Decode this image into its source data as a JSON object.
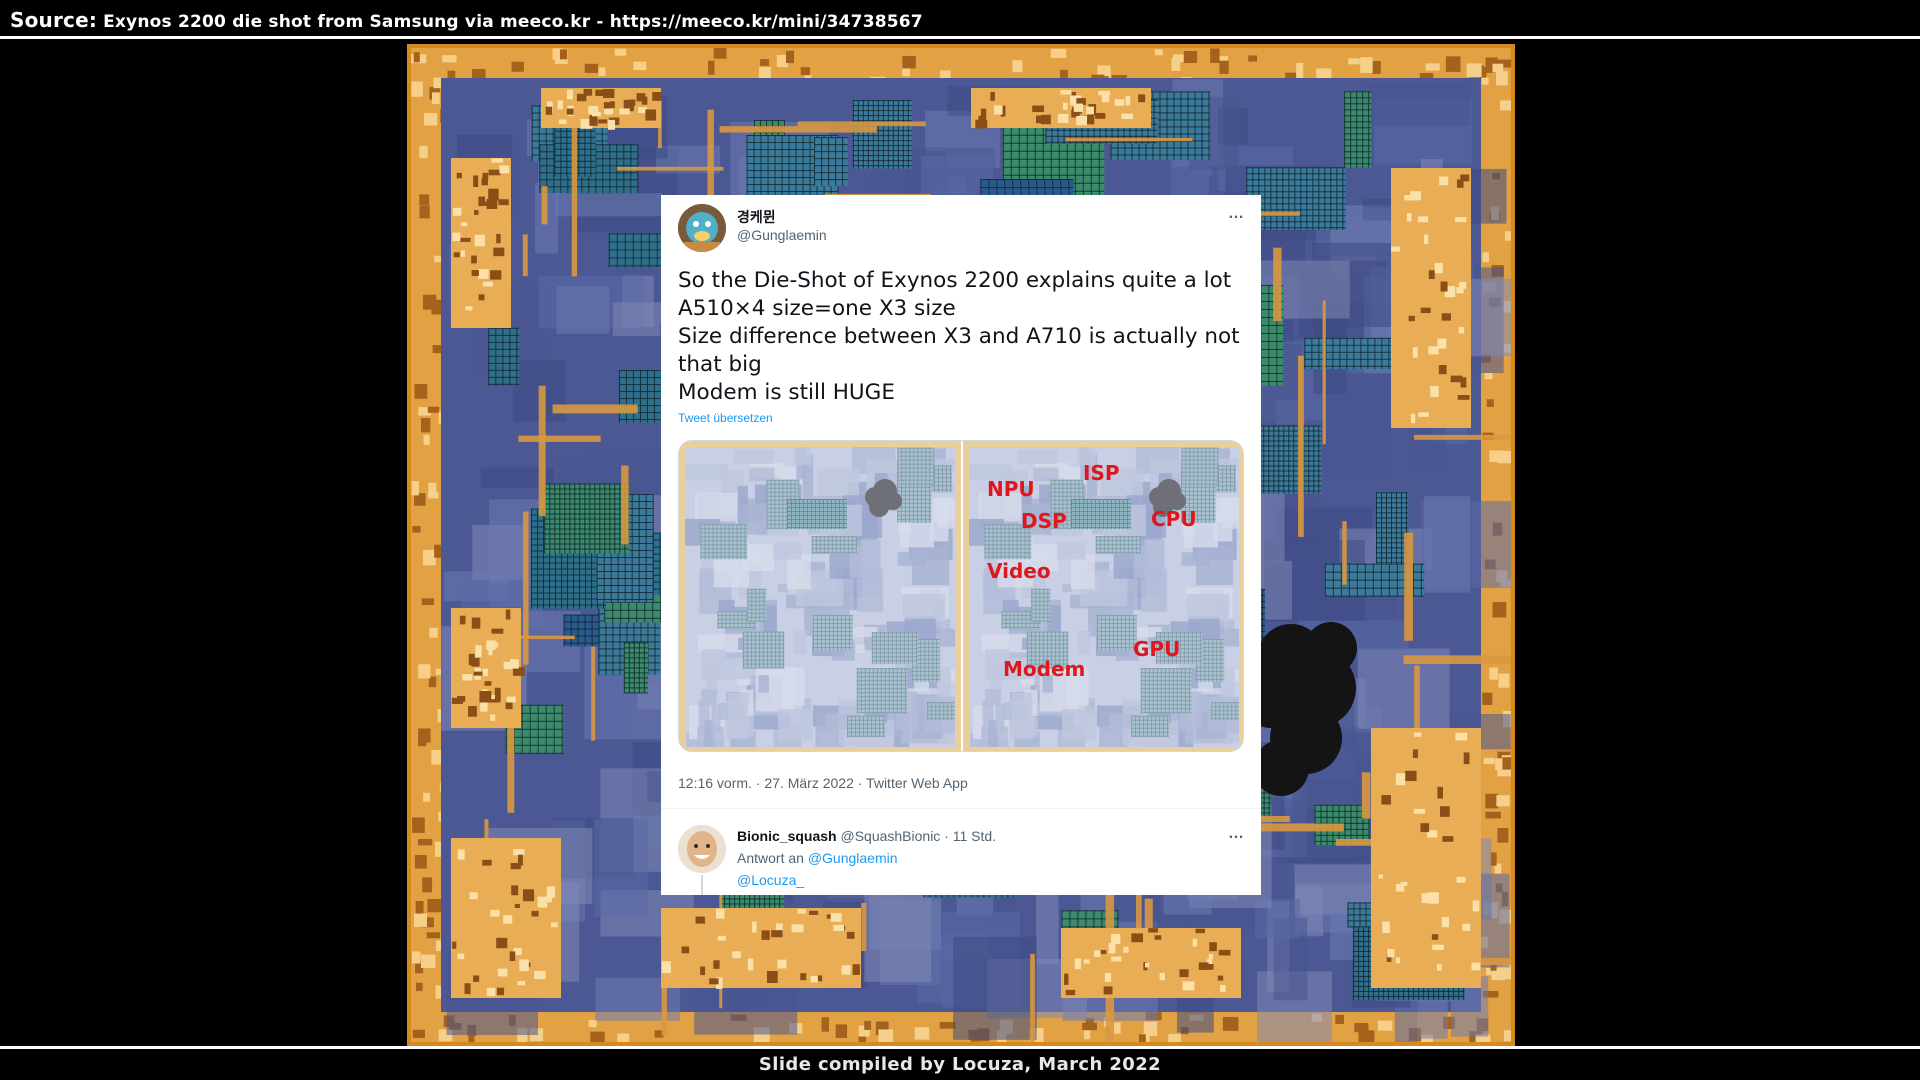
{
  "header": {
    "source_label": "Source:",
    "source_text": "Exynos 2200 die shot from Samsung via meeco.kr - https://meeco.kr/mini/34738567"
  },
  "footer": {
    "credit": "Slide compiled by Locuza, March 2022"
  },
  "tweet": {
    "author_name": "경케뮌",
    "author_handle": "@Gunglaemin",
    "more_icon": "…",
    "lines": [
      "So the Die-Shot of Exynos 2200 explains quite a lot",
      "A510×4 size=one X3 size",
      "Size difference between X3 and A710 is actually not",
      "that big",
      "Modem is still HUGE"
    ],
    "translate": "Tweet übersetzen",
    "media_labels": [
      "NPU",
      "ISP",
      "DSP",
      "CPU",
      "Video",
      "GPU",
      "Modem"
    ],
    "meta": "12:16 vorm. · 27. März 2022 · Twitter Web App"
  },
  "reply": {
    "name": "Bionic_squash",
    "handle": "@SquashBionic",
    "time": "· 11 Std.",
    "reply_prefix": "Antwort an",
    "reply_to_1": "@Gunglaemin",
    "reply_to_2": "@Locuza_",
    "more_icon": "…"
  },
  "colors": {
    "die_border": "#d48a1e",
    "die_blue": "#4a5a9a",
    "die_orange": "#e0a040",
    "label_red": "#e0161c",
    "link_blue": "#1d9bf0"
  }
}
